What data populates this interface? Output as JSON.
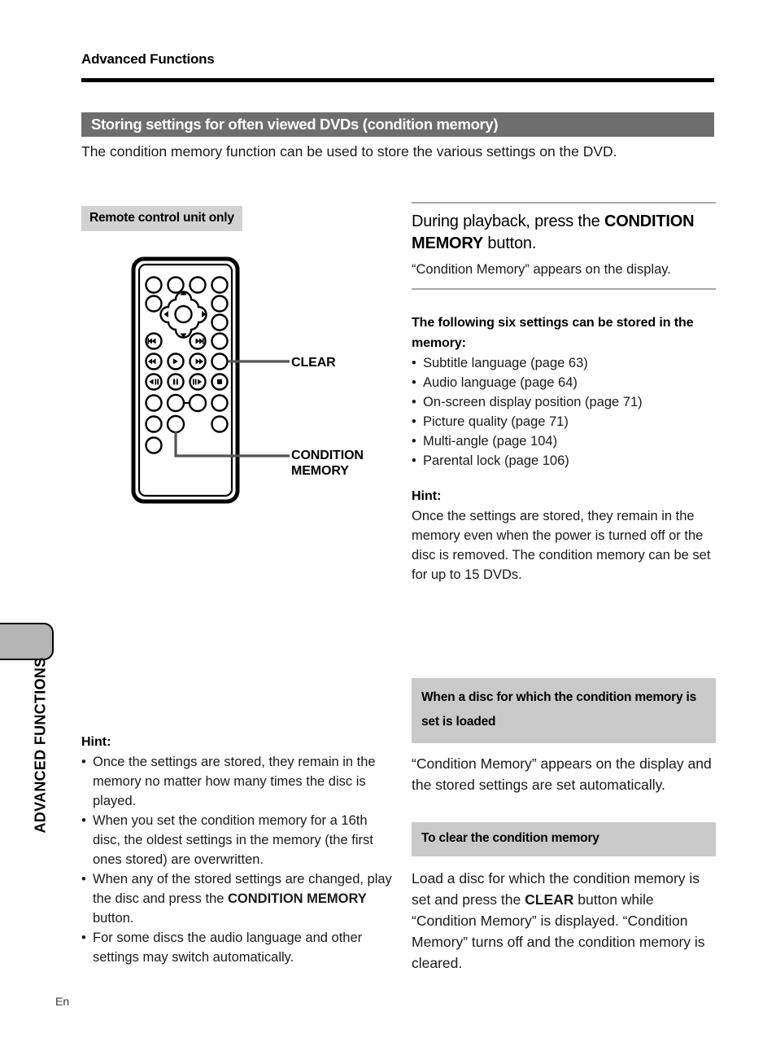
{
  "page": {
    "running_head": "Advanced Functions",
    "folio": "En",
    "side_tab_label": "ADVANCED FUNCTIONS"
  },
  "section": {
    "title": "Storing settings for often viewed DVDs (condition memory)",
    "intro": "The condition memory function can be used to store the various settings on the DVD."
  },
  "left_column": {
    "remote_label": "Remote control unit only",
    "callouts": {
      "clear": "CLEAR",
      "condition_memory_line1": "CONDITION",
      "condition_memory_line2": "MEMORY"
    },
    "hint": {
      "label": "Hint:",
      "items": [
        "Once the settings are stored, they remain in the memory no matter how many times the disc is played.",
        "When you set the condition memory for a 16th disc, the oldest settings in the memory (the first ones stored) are overwritten.",
        "When any of the stored settings are changed, play the disc and press the CONDITION MEMORY button.",
        "For some discs the audio language and other settings may switch automatically."
      ],
      "item3_pre": "When any of the stored settings are changed, play the disc and press the ",
      "item3_bold": "CONDITION MEMORY",
      "item3_post": " button."
    }
  },
  "right_column": {
    "step": {
      "line1": "During playback, press the ",
      "bold": "CONDITION MEMORY",
      "line2": " button.",
      "note": "“Condition Memory” appears on the display."
    },
    "settings": {
      "heading": "The following six settings can be stored in the memory:",
      "items": [
        "Subtitle language (page 63)",
        "Audio language (page 64)",
        "On-screen display position (page 71)",
        "Picture quality (page 71)",
        "Multi-angle (page 104)",
        "Parental lock (page 106)"
      ]
    },
    "hint": {
      "label": "Hint:",
      "text": "Once the settings are stored, they remain in the memory even when the power is turned off or the disc is removed.  The condition memory can be set for up to 15 DVDs."
    },
    "loaded_box": {
      "heading": "When a disc for which the condition memory is set is loaded",
      "text": "“Condition Memory” appears on the display and the stored settings are set automatically."
    },
    "clear_box": {
      "heading": "To clear the condition memory",
      "text_pre": "Load a disc for which the condition memory is set and press the ",
      "text_bold": "CLEAR",
      "text_post": " button while “Condition Memory” is displayed.  “Condition Memory” turns off and the condition memory is cleared."
    }
  },
  "colors": {
    "title_bar": "#6e6e6e",
    "label_bar": "#d2d2d2",
    "box_bar": "#c9c9c9",
    "tab_fill": "#b4b4b4"
  }
}
